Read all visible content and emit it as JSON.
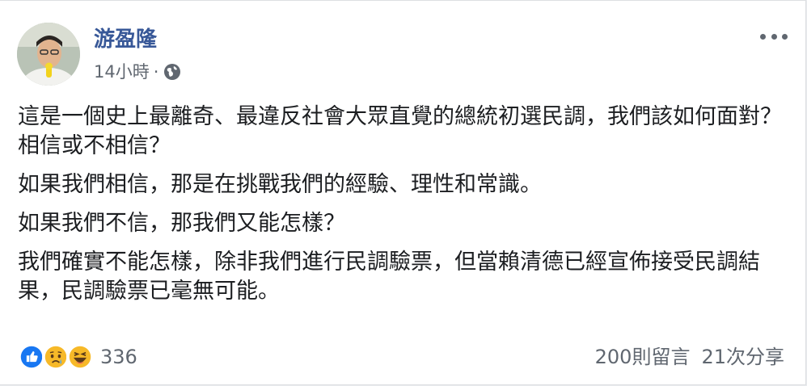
{
  "post": {
    "author": "游盈隆",
    "timestamp": "14小時",
    "separator": "·",
    "visibility_icon": "globe-icon",
    "menu_icon": "more-options-icon",
    "paragraphs": [
      "這是一個史上最離奇、最違反社會大眾直覺的總統初選民調，我們該如何面對？相信或不相信？",
      "如果我們相信，那是在挑戰我們的經驗、理性和常識。",
      "如果我們不信，那我們又能怎樣？",
      "我們確實不能怎樣，除非我們進行民調驗票，但當賴清德已經宣佈接受民調結果，民調驗票已毫無可能。"
    ]
  },
  "stats": {
    "reactions": [
      "like-icon",
      "sad-icon",
      "haha-icon"
    ],
    "reaction_count": "336",
    "comments": "200則留言",
    "shares": "21次分享"
  },
  "colors": {
    "author": "#385898",
    "meta": "#606770",
    "text": "#1c1e21",
    "like_blue": "#1877f2",
    "emoji_yellow": "#f7b928"
  }
}
